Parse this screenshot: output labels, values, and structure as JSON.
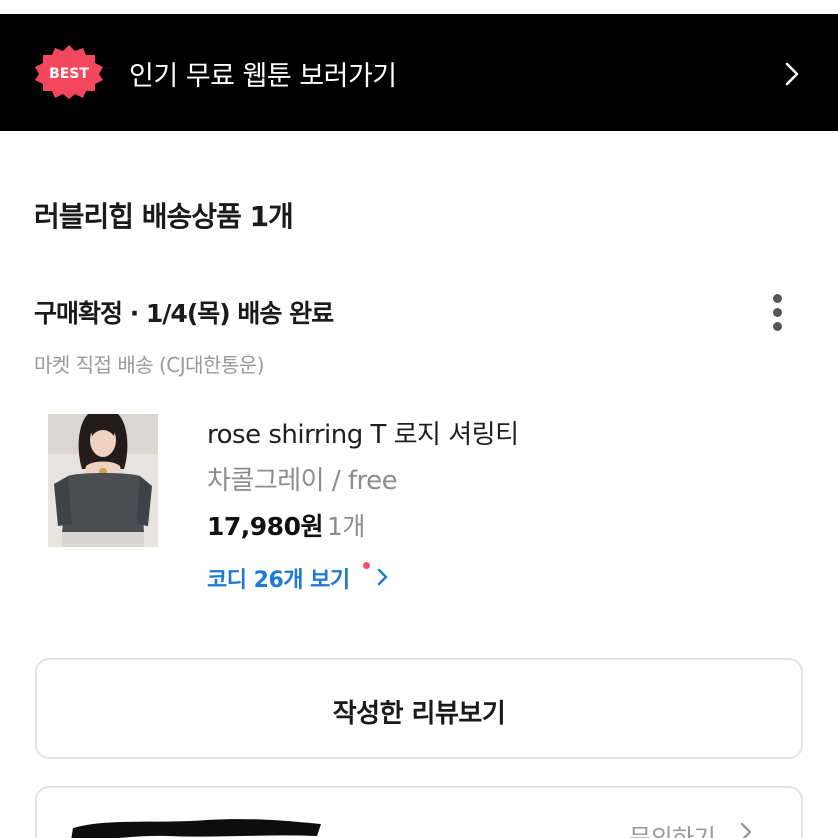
{
  "banner": {
    "badge": "BEST",
    "text": "인기 무료 웹툰 보러가기",
    "icon": "chevron-right-icon"
  },
  "seller": {
    "title": "러블리힙 배송상품 1개"
  },
  "order": {
    "status": "구매확정 · 1/4(목) 배송 완료",
    "delivery": "마켓 직접 배송 (CJ대한통운)",
    "menu_icon": "more-vertical-icon"
  },
  "product": {
    "name": "rose shirring T 로지 셔링티",
    "option": "차콜그레이 / free",
    "price": "17,980원",
    "quantity": "1개",
    "coordi_link": "코디 26개 보기"
  },
  "review_button": {
    "label": "작성한 리뷰보기"
  },
  "inquiry": {
    "label": "문의하기"
  },
  "colors": {
    "banner_bg": "#000000",
    "badge": "#f4475e",
    "link": "#1e78d6",
    "muted": "#9a9a9a"
  }
}
